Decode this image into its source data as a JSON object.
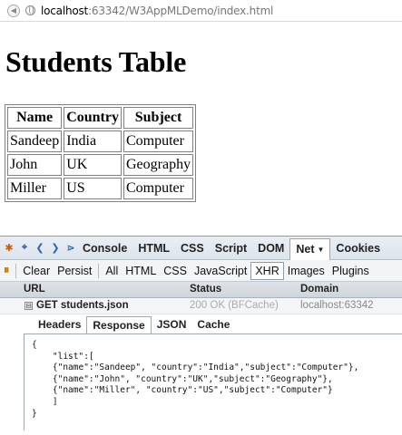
{
  "browser": {
    "url_host": "localhost",
    "url_path": ":63342/W3AppMLDemo/index.html"
  },
  "page": {
    "title": "Students Table",
    "table": {
      "headers": [
        "Name",
        "Country",
        "Subject"
      ],
      "rows": [
        [
          "Sandeep",
          "India",
          "Computer"
        ],
        [
          "John",
          "UK",
          "Geography"
        ],
        [
          "Miller",
          "US",
          "Computer"
        ]
      ]
    }
  },
  "firebug": {
    "tabs": [
      "Console",
      "HTML",
      "CSS",
      "Script",
      "DOM",
      "Net",
      "Cookies"
    ],
    "selected_tab": "Net",
    "net_toolbar": {
      "clear": "Clear",
      "persist": "Persist",
      "filters": [
        "All",
        "HTML",
        "CSS",
        "JavaScript",
        "XHR",
        "Images",
        "Plugins"
      ],
      "selected_filter": "XHR"
    },
    "columns": {
      "url": "URL",
      "status": "Status",
      "domain": "Domain"
    },
    "request": {
      "toggle": "⊟",
      "label": "GET students.json",
      "status": "200 OK (BFCache)",
      "domain": "localhost:63342"
    },
    "detail_tabs": [
      "Headers",
      "Response",
      "JSON",
      "Cache"
    ],
    "selected_detail_tab": "Response",
    "response_lines": [
      "{",
      "    \"list\":[",
      "    {\"name\":\"Sandeep\", \"country\":\"India\",\"subject\":\"Computer\"},",
      "    {\"name\":\"John\", \"country\":\"UK\",\"subject\":\"Geography\"},",
      "    {\"name\":\"Miller\", \"country\":\"US\",\"subject\":\"Computer\"}",
      "    ]",
      "}"
    ]
  }
}
